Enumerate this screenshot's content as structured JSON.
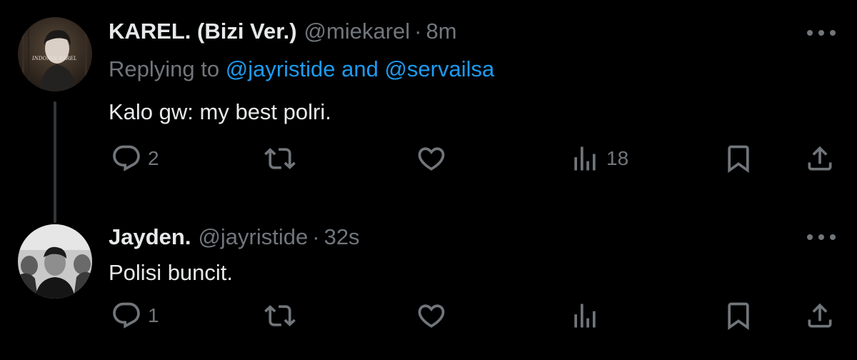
{
  "tweets": [
    {
      "display_name": "KAREL. (Bizi Ver.)",
      "handle": "@miekarel",
      "separator": "·",
      "time": "8m",
      "replying_prefix": "Replying to",
      "replying_handles": "@jayristide and @servailsa",
      "text": "Kalo gw: my best polri.",
      "avatar_text": "INDOMIE KAREL",
      "actions": {
        "reply_count": "2",
        "retweet_count": "",
        "like_count": "",
        "views_count": "18"
      }
    },
    {
      "display_name": "Jayden.",
      "handle": "@jayristide",
      "separator": "·",
      "time": "32s",
      "text": "Polisi buncit.",
      "actions": {
        "reply_count": "1",
        "retweet_count": "",
        "like_count": "",
        "views_count": ""
      }
    }
  ],
  "icons": {
    "reply": "reply-icon",
    "retweet": "retweet-icon",
    "like": "heart-icon",
    "views": "views-icon",
    "bookmark": "bookmark-icon",
    "share": "share-icon",
    "more": "more-icon"
  },
  "colors": {
    "background": "#000000",
    "primary_text": "#e7e9ea",
    "secondary_text": "#71767b",
    "link": "#1d9bf0",
    "thread_line": "#333639"
  }
}
